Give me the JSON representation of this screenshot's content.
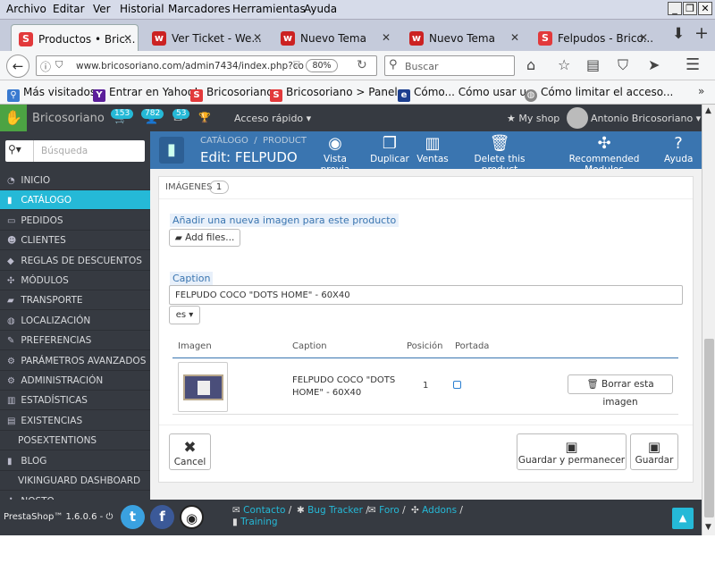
{
  "menu": {
    "items": [
      "Archivo",
      "Editar",
      "Ver",
      "Historial",
      "Marcadores",
      "Herramientas",
      "Ayuda"
    ]
  },
  "tabs": [
    {
      "label": "Productos • Bric...",
      "icon": "prestashop-icon",
      "color": "#e2393b"
    },
    {
      "label": "Ver Ticket - We...",
      "icon": "webempresa-icon",
      "color": "#cc2222"
    },
    {
      "label": "Nuevo Tema",
      "icon": "webempresa-icon",
      "color": "#cc2222"
    },
    {
      "label": "Nuevo Tema",
      "icon": "webempresa-icon",
      "color": "#cc2222"
    },
    {
      "label": "Felpudos - Brico...",
      "icon": "prestashop-icon",
      "color": "#e2393b"
    }
  ],
  "nav": {
    "url": "www.bricosoriano.com/admin7434/index.php?co",
    "zoom": "80%",
    "search_placeholder": "Buscar"
  },
  "bookmarks": [
    "Más visitados",
    "Entrar en Yahoo!",
    "Bricosoriano",
    "Bricosoriano > Panel ...",
    "Cómo... Cómo usar u...",
    "Cómo limitar el acceso..."
  ],
  "header": {
    "shop_name": "Bricosoriano",
    "badges": [
      "153",
      "782",
      "53"
    ],
    "quick_access": "Acceso rápido",
    "my_shop": "My shop",
    "user": "Antonio Bricosoriano"
  },
  "sidebar": {
    "search_placeholder": "Búsqueda",
    "items": [
      {
        "label": "INICIO",
        "icon": "dashboard-icon"
      },
      {
        "label": "CATÁLOGO",
        "icon": "book-icon",
        "active": true
      },
      {
        "label": "PEDIDOS",
        "icon": "credit-card-icon"
      },
      {
        "label": "CLIENTES",
        "icon": "users-icon"
      },
      {
        "label": "REGLAS DE DESCUENTOS",
        "icon": "tag-icon"
      },
      {
        "label": "MÓDULOS",
        "icon": "puzzle-icon"
      },
      {
        "label": "TRANSPORTE",
        "icon": "truck-icon"
      },
      {
        "label": "LOCALIZACIÓN",
        "icon": "globe-icon"
      },
      {
        "label": "PREFERENCIAS",
        "icon": "wrench-icon"
      },
      {
        "label": "PARÁMETROS AVANZADOS",
        "icon": "cogs-icon"
      },
      {
        "label": "ADMINISTRACIÓN",
        "icon": "cog-icon"
      },
      {
        "label": "ESTADÍSTICAS",
        "icon": "bar-chart-icon"
      },
      {
        "label": "EXISTENCIAS",
        "icon": "archive-icon"
      },
      {
        "label": "POSEXTENTIONS",
        "icon": ""
      },
      {
        "label": "BLOG",
        "icon": "book-icon"
      },
      {
        "label": "VIKINGUARD DASHBOARD",
        "icon": ""
      },
      {
        "label": "NOSTO",
        "icon": "puzzle-icon"
      }
    ]
  },
  "toolbar": {
    "breadcrumb_1": "CATÁLOGO",
    "breadcrumb_2": "PRODUCT",
    "title": "Edit: FELPUDO C",
    "buttons": [
      "Vista previa",
      "Duplicar",
      "Ventas",
      "Delete this product",
      "Recommended Modules",
      "Ayuda"
    ]
  },
  "images_panel": {
    "heading": "IMÁGENES",
    "count": "1",
    "add_label": "Añadir una nueva imagen para este producto",
    "add_files": "Add files...",
    "caption_label": "Caption",
    "caption_value": "FELPUDO COCO \"DOTS HOME\" - 60X40",
    "lang": "es",
    "table_headers": [
      "Imagen",
      "Caption",
      "Posición",
      "Portada"
    ],
    "row": {
      "caption": "FELPUDO COCO \"DOTS HOME\" - 60X40",
      "position": "1",
      "delete_label": "Borrar esta imagen"
    },
    "cancel": "Cancel",
    "save_stay": "Guardar y permanecer",
    "save": "Guardar"
  },
  "footer": {
    "version": "PrestaShop™ 1.6.0.6 -",
    "links": [
      "Contacto",
      "Bug Tracker",
      "Foro",
      "Addons",
      "Training"
    ]
  },
  "colors": {
    "accent": "#25b9d7",
    "toolbar": "#3a75b0",
    "dark": "#363a41"
  }
}
